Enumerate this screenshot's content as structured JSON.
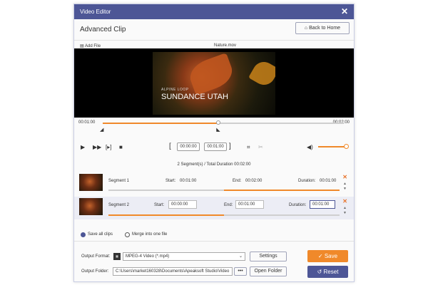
{
  "window": {
    "title": "Video Editor",
    "close_symbol": "✕"
  },
  "header": {
    "title": "Advanced Clip",
    "home_label": "Back to Home"
  },
  "file": {
    "add_label": "Add File",
    "name": "Nature.mov"
  },
  "preview": {
    "subtitle": "ALPINE LOOP",
    "title": "SUNDANCE UTAH"
  },
  "timeline": {
    "start": "00:01:00",
    "end": "00:02:00",
    "progress_fraction": 0.48
  },
  "controls": {
    "start_time": "00:00:00",
    "end_time": "00:01:00",
    "volume_fraction": 0.9
  },
  "summary": "2 Segment(s) / Total Duration 00:02:00",
  "segments": [
    {
      "name": "Segment 1",
      "start_label": "Start:",
      "start": "00:01:00",
      "end_label": "End:",
      "end": "00:02:00",
      "duration_label": "Duration:",
      "duration": "00:01:00",
      "range": [
        0.5,
        1.0
      ]
    },
    {
      "name": "Segment 2",
      "start_label": "Start:",
      "start": "00:00:00",
      "end_label": "End:",
      "end": "00:01:00",
      "duration_label": "Duration:",
      "duration": "00:01:00",
      "range": [
        0.0,
        0.5
      ]
    }
  ],
  "options": {
    "save_all": "Save all clips",
    "merge": "Merge into one file",
    "selected": "save_all"
  },
  "output": {
    "format_label": "Output Format:",
    "format_value": "MPEG-4 Video (*.mp4)",
    "settings_label": "Settings",
    "folder_label": "Output Folder:",
    "folder_value": "C:\\Users\\market160328\\Documents\\Apeaksoft Studio\\Video",
    "more_label": "•••",
    "open_folder_label": "Open Folder"
  },
  "actions": {
    "save_label": "Save",
    "reset_label": "Reset"
  },
  "colors": {
    "accent": "#f0892a",
    "title_bar": "#4d5696",
    "reset": "#4d5696"
  }
}
